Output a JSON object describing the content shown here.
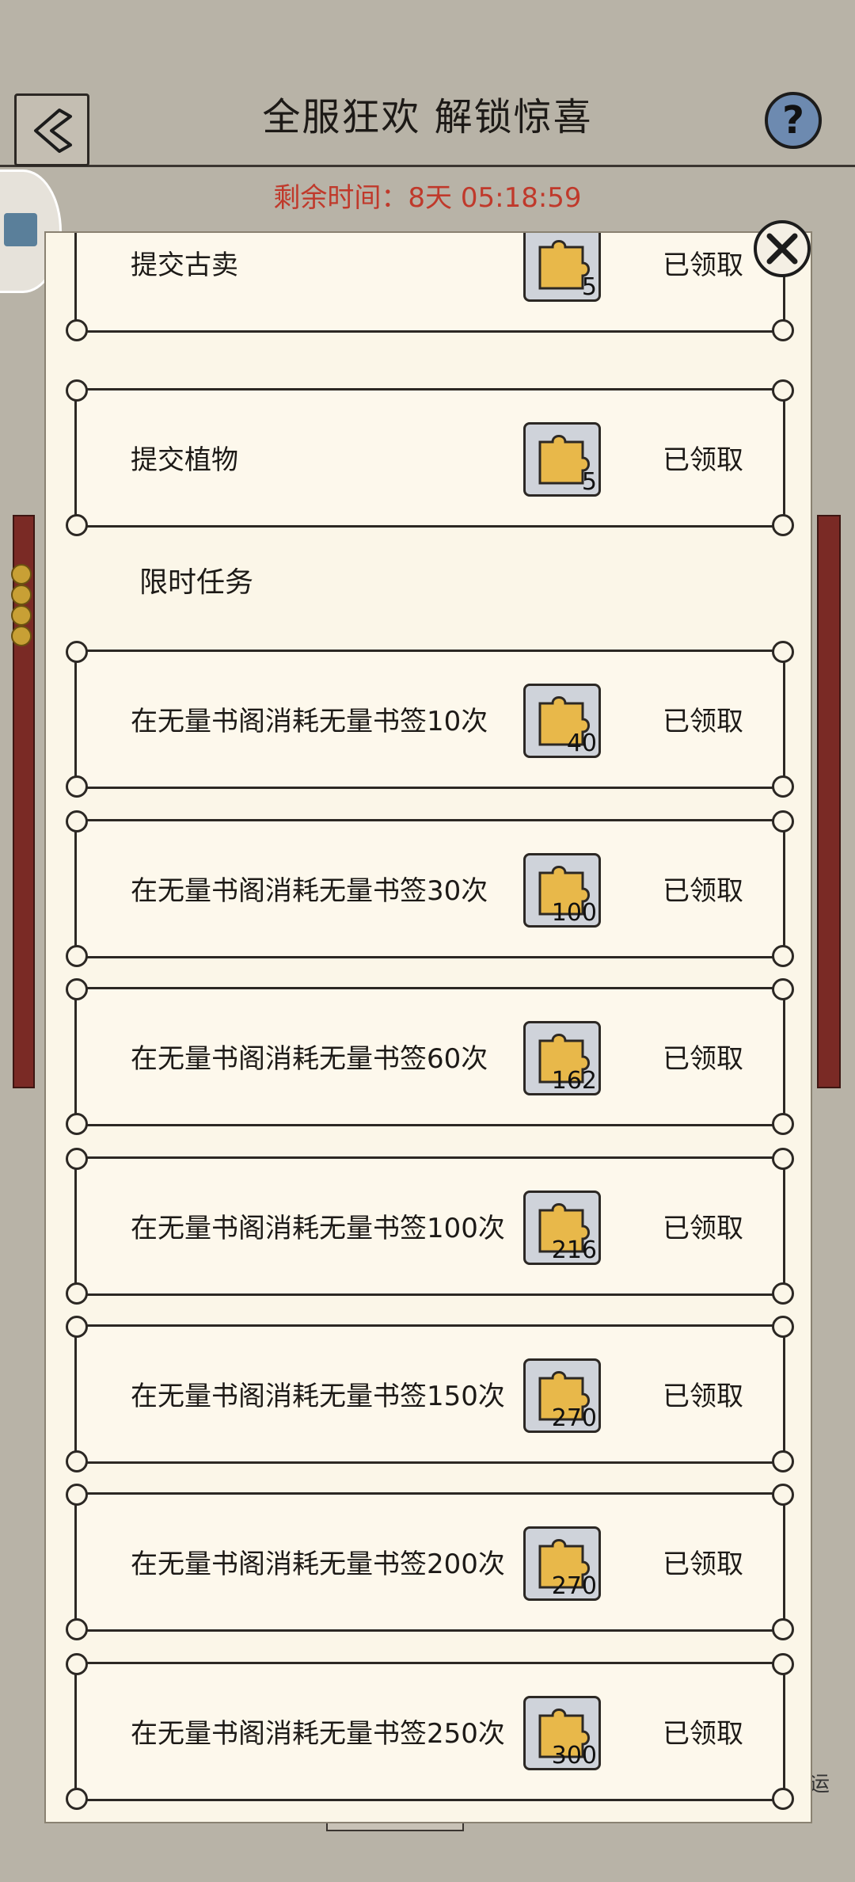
{
  "header": {
    "title": "全服狂欢 解锁惊喜",
    "timer": "剩余时间：8天 05:18:59",
    "help_label": "?"
  },
  "section_title": "限时任务",
  "status_claimed": "已领取",
  "corner_text": "运",
  "top_tasks": [
    {
      "label": "提交古卖",
      "reward": "5"
    },
    {
      "label": "提交植物",
      "reward": "5"
    }
  ],
  "timed_tasks": [
    {
      "label": "在无量书阁消耗无量书签10次",
      "reward": "40"
    },
    {
      "label": "在无量书阁消耗无量书签30次",
      "reward": "100"
    },
    {
      "label": "在无量书阁消耗无量书签60次",
      "reward": "162"
    },
    {
      "label": "在无量书阁消耗无量书签100次",
      "reward": "216"
    },
    {
      "label": "在无量书阁消耗无量书签150次",
      "reward": "270"
    },
    {
      "label": "在无量书阁消耗无量书签200次",
      "reward": "270"
    },
    {
      "label": "在无量书阁消耗无量书签250次",
      "reward": "300"
    }
  ],
  "colors": {
    "timer": "#c0392b",
    "reward_fill": "#e8b84a",
    "panel": "#fbf6e8"
  }
}
